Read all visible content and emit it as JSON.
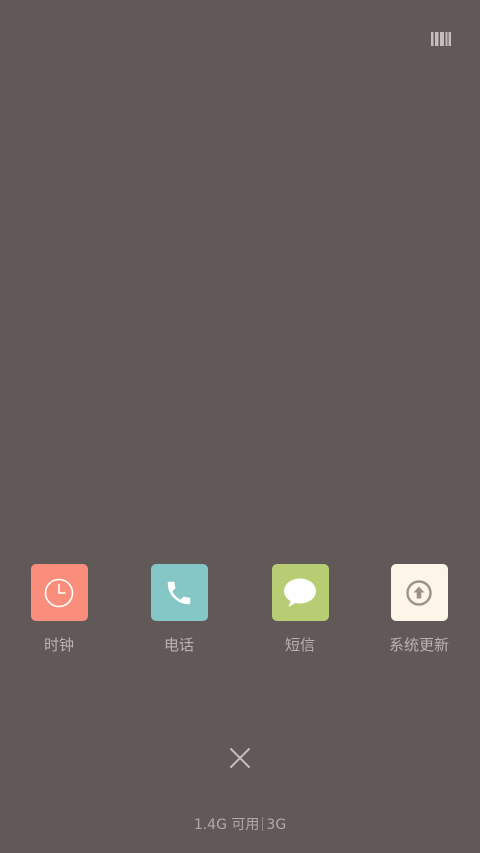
{
  "recent_apps": [
    {
      "label": "时钟",
      "icon": "clock-icon",
      "color": "#f98e7d"
    },
    {
      "label": "电话",
      "icon": "phone-icon",
      "color": "#85c7c6"
    },
    {
      "label": "短信",
      "icon": "message-icon",
      "color": "#b8cd73"
    },
    {
      "label": "系统更新",
      "icon": "system-update-icon",
      "color": "#fdf6e8"
    }
  ],
  "memory": {
    "available": "1.4G 可用",
    "total": "3G"
  },
  "top_right_icon": "grid-view-icon",
  "close_icon": "close-icon"
}
